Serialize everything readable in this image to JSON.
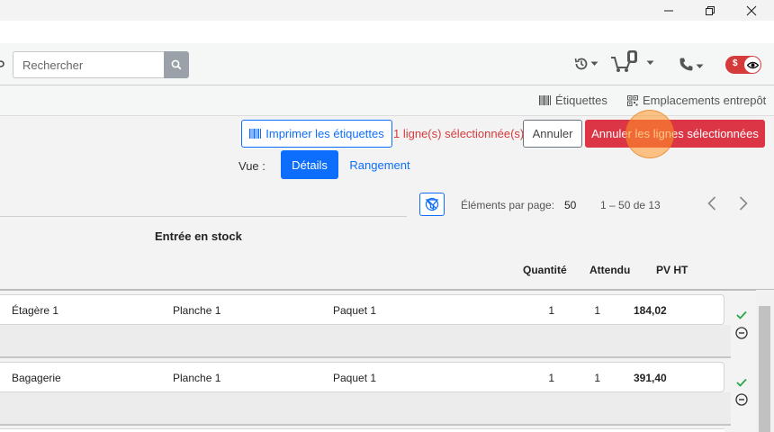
{
  "header": {
    "search_placeholder": "Rechercher"
  },
  "subheader": {
    "labels_link": "Étiquettes",
    "locations_link": "Emplacements entrepôt"
  },
  "actions": {
    "print_labels": "Imprimer les étiquettes",
    "selected_count": "1 ligne(s) sélectionnée(s)",
    "cancel": "Annuler",
    "cancel_selected": "Annuler les lignes sélectionnées"
  },
  "view": {
    "label": "Vue :",
    "tabs": [
      "Détails",
      "Rangement"
    ],
    "active_tab": "Détails"
  },
  "paginator": {
    "per_page_label": "Éléments par page:",
    "per_page_value": "50",
    "range": "1 – 50 de 13"
  },
  "table": {
    "group_header": "Entrée en stock",
    "columns": [
      "Quantité",
      "Attendu",
      "PV HT"
    ],
    "rows": [
      {
        "location": "Étagère 1",
        "shelf": "Planche 1",
        "package": "Paquet 1",
        "quantity": "1",
        "expected": "1",
        "price": "184,02"
      },
      {
        "location": "Bagagerie",
        "shelf": "Planche 1",
        "package": "Paquet 1",
        "quantity": "1",
        "expected": "1",
        "price": "391,40"
      }
    ]
  },
  "colors": {
    "primary": "#0d6efd",
    "danger": "#dc3545",
    "success": "#28a745",
    "toggle": "#d63b3b"
  },
  "icons": [
    "minimize-icon",
    "restore-icon",
    "close-icon",
    "search-icon",
    "history-icon",
    "cart-icon",
    "phone-icon",
    "eye-icon",
    "barcode-icon",
    "qr-icon",
    "filter-off-icon",
    "chevron-left-icon",
    "chevron-right-icon",
    "check-icon",
    "minus-circle-icon"
  ]
}
